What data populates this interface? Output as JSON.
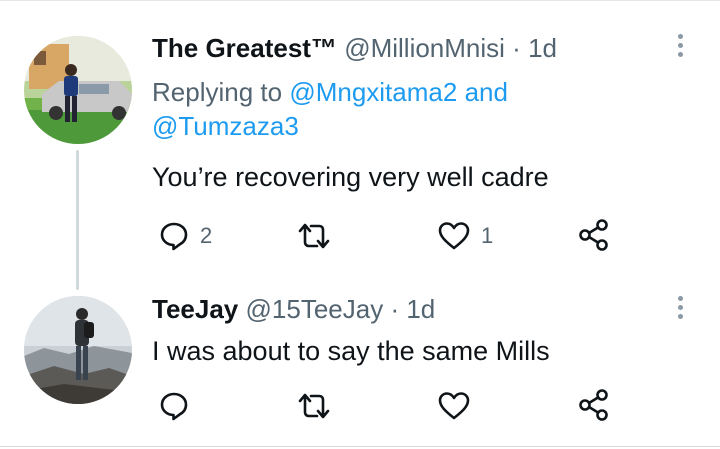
{
  "tweets": [
    {
      "display_name": "The Greatest™",
      "handle": "@MillionMnisi",
      "separator": "·",
      "time": "1d",
      "replying_prefix": "Replying to",
      "mention_1": "@Mngxitama2",
      "mention_joiner": "and",
      "mention_2": "@Tumzaza3",
      "text": "You’re recovering very well cadre",
      "reply_count": "2",
      "retweet_count": "",
      "like_count": "1"
    },
    {
      "display_name": "TeeJay",
      "handle": "@15TeeJay",
      "separator": "·",
      "time": "1d",
      "text": "I was about to say the same Mills",
      "reply_count": "",
      "retweet_count": "",
      "like_count": ""
    }
  ],
  "icons": {
    "reply": "reply-bubble-icon",
    "retweet": "retweet-icon",
    "like": "heart-icon",
    "share": "share-icon",
    "more": "more-vertical-icon"
  },
  "colors": {
    "name": "#0f1419",
    "muted": "#536471",
    "link": "#1d9bf0",
    "thread_line": "#cfd9de"
  }
}
